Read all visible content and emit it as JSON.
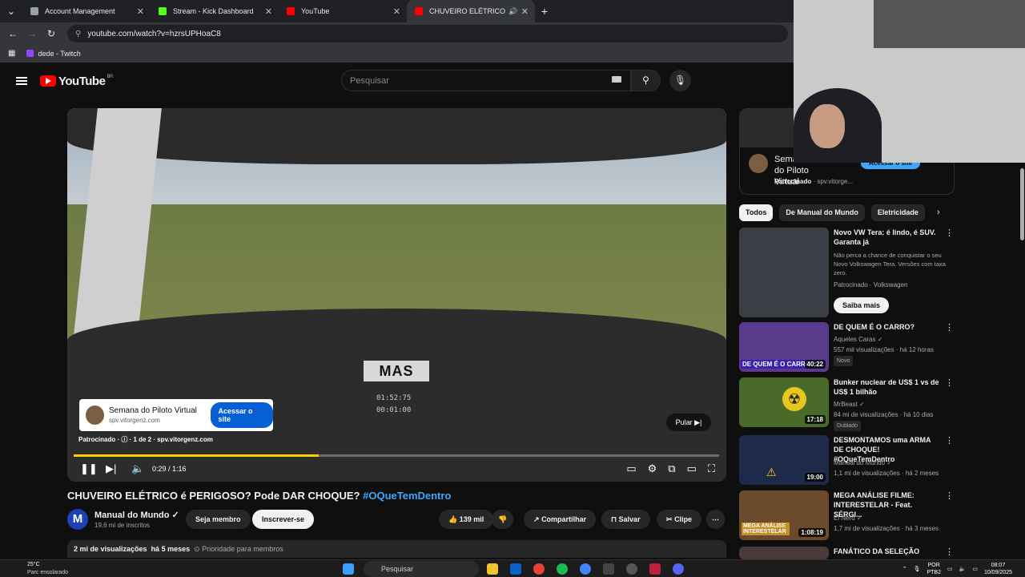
{
  "browser": {
    "tabs": [
      {
        "title": "Account Management",
        "icon_color": "#9aa0a6"
      },
      {
        "title": "Stream - Kick Dashboard",
        "icon_color": "#53fc18"
      },
      {
        "title": "YouTube",
        "icon_color": "#ff0000"
      },
      {
        "title": "CHUVEIRO ELÉTRICO é PERIGOSO",
        "icon_color": "#ff0000"
      }
    ],
    "new_tab_label": "+",
    "url": "youtube.com/watch?v=hzrsUPHoaC8",
    "bookmark": "dede - Twitch"
  },
  "youtube": {
    "logo_text": "YouTube",
    "logo_region": "BR",
    "search_placeholder": "Pesquisar"
  },
  "video": {
    "display_text": "MAS",
    "display_time1": "01:52:75",
    "display_time2": "00:01:00",
    "ad_title": "Semana do Piloto Virtual",
    "ad_domain": "spv.vitorgenz.com",
    "ad_button": "Acessar o site",
    "ad_info": "Patrocinado · ⓘ · 1 de 2 · spv.vitorgenz.com",
    "skip_label": "Pular ▶|",
    "time": "0:29 / 1:16",
    "progress": 0.38
  },
  "meta": {
    "title": "CHUVEIRO ELÉTRICO é PERIGOSO? Pode DAR CHOQUE?",
    "hashtag": "#OQueTemDentro",
    "channel_initial": "M",
    "channel_name": "Manual do Mundo ✓",
    "subscribers": "19,6 mi de inscritos",
    "join_label": "Seja membro",
    "subscribe_label": "Inscrever-se",
    "likes": "139 mil",
    "share_label": "Compartilhar",
    "save_label": "Salvar",
    "clip_label": "Clipe",
    "views": "2 mi de visualizações",
    "age": "há 5 meses",
    "priority": "⊙ Prioridade para membros"
  },
  "sidebar_ad": {
    "title": "Semana do Piloto Virtual",
    "sponsor_label": "Patrocinado",
    "domain": "spv.vitorge...",
    "button": "Acessar o site"
  },
  "chips": [
    "Todos",
    "De Manual do Mundo",
    "Eletricidade"
  ],
  "recommendations": [
    {
      "title": "Novo VW Tera: é lindo, é SUV. Garanta já",
      "line1": "Não perca a chance de conquistar o seu Novo Volkswagen Tera. Versões com taxa zero.",
      "line2": "Patrocinado · Volkswagen",
      "duration": "",
      "badge": "",
      "cta": "Saiba mais"
    },
    {
      "title": "DE QUEM É O CARRO?",
      "line1": "Aqueles Caras ✓",
      "line2": "557 mil visualizações · há 12 horas",
      "duration": "40:22",
      "badge": "Novo",
      "thumb_text": "DE QUEM É O CARRO"
    },
    {
      "title": "Bunker nuclear de US$ 1 vs de US$ 1 bilhão",
      "line1": "MrBeast ✓",
      "line2": "84 mi de visualizações · há 10 dias",
      "duration": "17:18",
      "badge": "Dublado"
    },
    {
      "title": "DESMONTAMOS uma ARMA DE CHOQUE! #OQueTemDentro",
      "line1": "Manual do Mundo ✓",
      "line2": "1,1 mi de visualizações · há 2 meses",
      "duration": "19:00",
      "badge": ""
    },
    {
      "title": "MEGA ANÁLISE FILME: INTERESTELAR - Feat. SÉRGI...",
      "line1": "El Nerd ✓",
      "line2": "1,7 mi de visualizações · há 3 meses",
      "duration": "1:08:19",
      "badge": "",
      "thumb_text": "MEGA ANÁLISE INTERESTELAR"
    },
    {
      "title": "FANÁTICO DA SELEÇÃO",
      "line1": "",
      "line2": "",
      "duration": "",
      "badge": ""
    }
  ],
  "taskbar": {
    "temp": "25°C",
    "weather": "Parc ensolarado",
    "search": "Pesquisar",
    "lang": "POR",
    "layout": "PTB2",
    "time": "08:07",
    "date": "10/09/2025"
  },
  "colors": {
    "accent_red": "#ff0000",
    "link_blue": "#3ea6ff",
    "progress": "#ffcc00",
    "ad_button": "#065fd4"
  }
}
